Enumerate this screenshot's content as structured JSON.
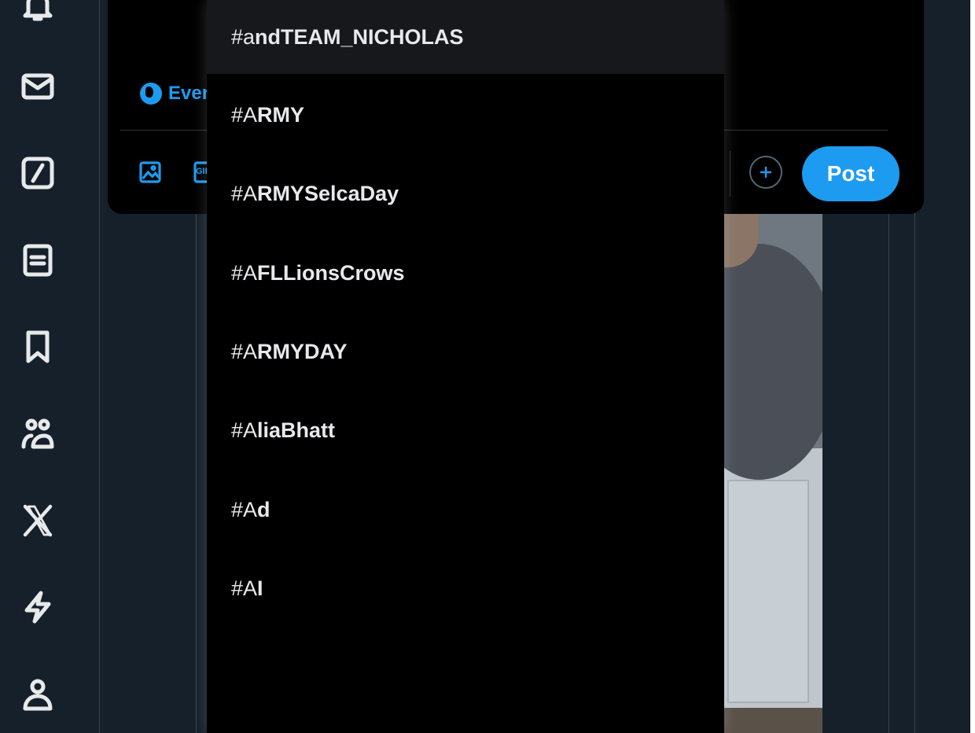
{
  "nav": {
    "items": [
      {
        "name": "notifications-icon"
      },
      {
        "name": "messages-icon"
      },
      {
        "name": "grok-icon"
      },
      {
        "name": "lists-icon"
      },
      {
        "name": "bookmarks-icon"
      },
      {
        "name": "communities-icon"
      },
      {
        "name": "premium-x-icon"
      },
      {
        "name": "verified-orgs-icon"
      },
      {
        "name": "profile-icon"
      }
    ]
  },
  "composer": {
    "audience_label": "Ever",
    "post_label": "Post",
    "gif_label": "GIF"
  },
  "suggestions": [
    {
      "prefix": "#a",
      "rest": "ndTEAM_NICHOLAS",
      "active": true
    },
    {
      "prefix": "#A",
      "rest": "RMY"
    },
    {
      "prefix": "#A",
      "rest": "RMYSelcaDay"
    },
    {
      "prefix": "#A",
      "rest": "FLLionsCrows"
    },
    {
      "prefix": "#A",
      "rest": "RMYDAY"
    },
    {
      "prefix": "#A",
      "rest": "liaBhatt"
    },
    {
      "prefix": "#A",
      "rest": "d"
    },
    {
      "prefix": "#A",
      "rest": "I"
    }
  ],
  "colors": {
    "accent": "#1d9bf0",
    "background": "#15202b",
    "dropdown": "#000000"
  }
}
